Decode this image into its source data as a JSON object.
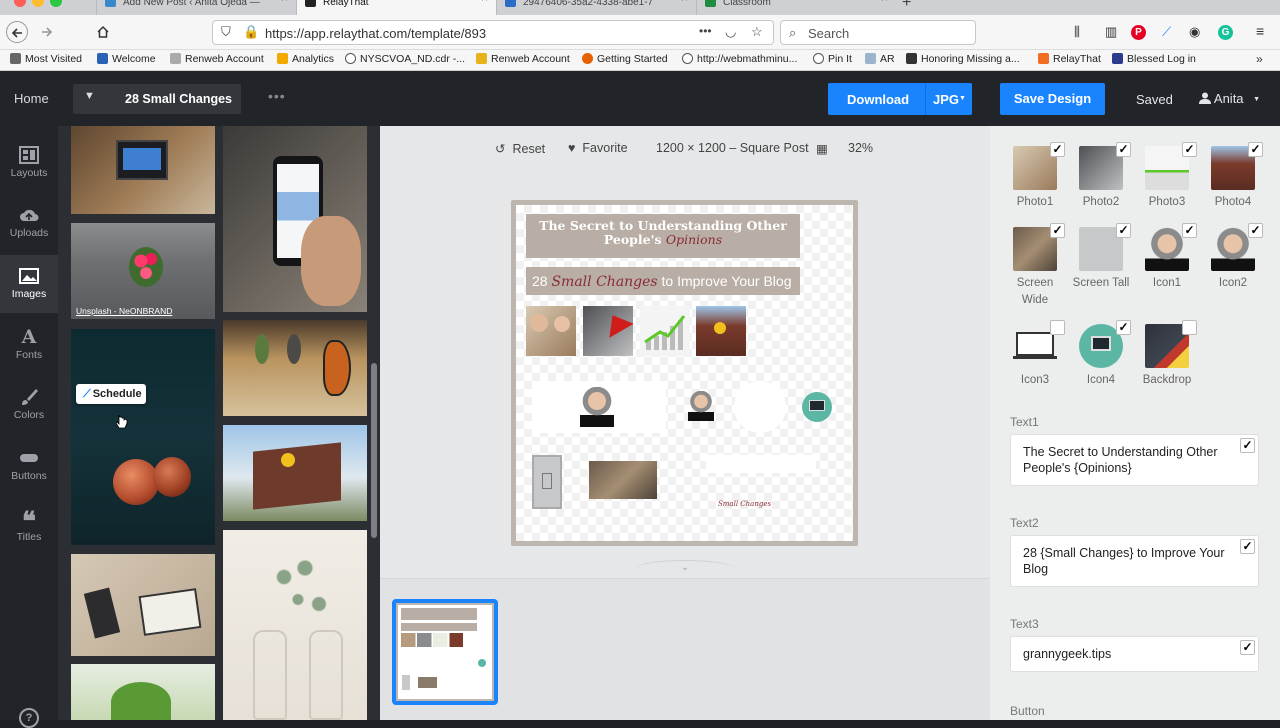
{
  "browser": {
    "tabs": [
      {
        "title": "Add New Post ‹ Anita Ojeda —",
        "active": false
      },
      {
        "title": "RelayThat",
        "active": true
      },
      {
        "title": "29476406-35a2-4338-abe1-7",
        "active": false
      },
      {
        "title": "Classroom",
        "active": false
      }
    ],
    "url": "https://app.relaythat.com/template/893",
    "search_placeholder": "Search",
    "bookmarks": [
      "Most Visited",
      "Welcome",
      "Renweb Account",
      "Analytics",
      "NYSCVOA_ND.cdr -...",
      "Renweb Account",
      "Getting Started",
      "http://webmathminu...",
      "Pin It",
      "AR",
      "Honoring Missing a...",
      "RelayThat",
      "Blessed Log in"
    ]
  },
  "header": {
    "home": "Home",
    "design_name": "28 Small Changes",
    "more": "•••",
    "download": "Download",
    "format": "JPG",
    "save": "Save Design",
    "status": "Saved",
    "user": "Anita"
  },
  "sidebar": {
    "items": [
      {
        "label": "Layouts",
        "icon": "layouts-icon",
        "active": false
      },
      {
        "label": "Uploads",
        "icon": "upload-cloud-icon",
        "active": false
      },
      {
        "label": "Images",
        "icon": "image-icon",
        "active": true
      },
      {
        "label": "Fonts",
        "icon": "font-icon",
        "active": false
      },
      {
        "label": "Colors",
        "icon": "brush-icon",
        "active": false
      },
      {
        "label": "Buttons",
        "icon": "button-icon",
        "active": false
      },
      {
        "label": "Titles",
        "icon": "quote-icon",
        "active": false
      }
    ]
  },
  "image_panel": {
    "caption": "Unsplash - NeONBRAND",
    "schedule": "Schedule"
  },
  "toolbar": {
    "reset": "Reset",
    "favorite": "Favorite",
    "size": "1200 × 1200 – Square Post",
    "zoom": "32%"
  },
  "artwork": {
    "title_plain": "The Secret to Understanding Other People's",
    "title_script": "Opinions",
    "subtitle_pre": "28",
    "subtitle_script": "Small Changes",
    "subtitle_post": "to Improve Your Blog",
    "signature": "Small Changes"
  },
  "photos": [
    {
      "label": "Photo1",
      "checked": true
    },
    {
      "label": "Photo2",
      "checked": true
    },
    {
      "label": "Photo3",
      "checked": true
    },
    {
      "label": "Photo4",
      "checked": true
    },
    {
      "label": "Screen Wide",
      "checked": true
    },
    {
      "label": "Screen Tall",
      "checked": true
    },
    {
      "label": "Icon1",
      "checked": true
    },
    {
      "label": "Icon2",
      "checked": true
    },
    {
      "label": "Icon3",
      "checked": false
    },
    {
      "label": "Icon4",
      "checked": true
    },
    {
      "label": "Backdrop",
      "checked": false
    }
  ],
  "fields": [
    {
      "label": "Text1",
      "value": "The Secret to Understanding Other People's {Opinions}",
      "checked": true
    },
    {
      "label": "Text2",
      "value": "28 {Small Changes} to Improve Your Blog",
      "checked": true
    },
    {
      "label": "Text3",
      "value": "grannygeek.tips",
      "checked": true
    }
  ],
  "next_section": "Button",
  "colors": {
    "accent": "#1a84ff",
    "panel": "#212428",
    "title_bg": "#b8aea5",
    "script": "#8a2c36"
  }
}
